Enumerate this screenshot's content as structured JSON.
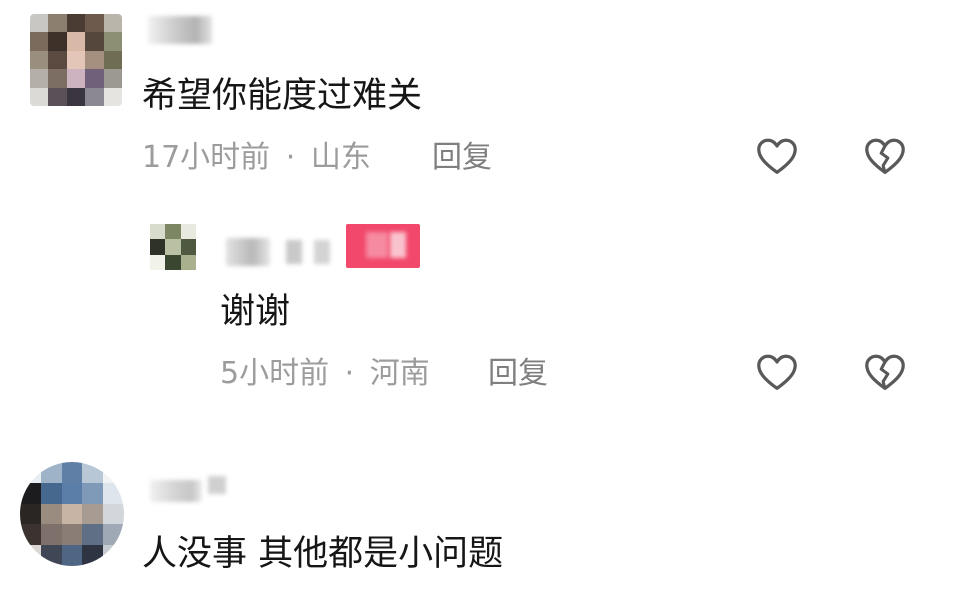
{
  "comments": [
    {
      "text": "希望你能度过难关",
      "time": "17小时前",
      "separator": "·",
      "location": "山东",
      "reply_label": "回复",
      "like_icon": "heart-outline-icon",
      "dislike_icon": "broken-heart-icon"
    },
    {
      "text": "人没事 其他都是小问题"
    }
  ],
  "replies": [
    {
      "text": "谢谢",
      "time": "5小时前",
      "separator": "·",
      "location": "河南",
      "reply_label": "回复",
      "author_badge_color": "#f2486b",
      "like_icon": "heart-outline-icon",
      "dislike_icon": "broken-heart-icon"
    }
  ],
  "colors": {
    "text": "#161616",
    "meta": "#9c9c9c",
    "reply": "#7f7f7f",
    "icon": "#595959"
  }
}
